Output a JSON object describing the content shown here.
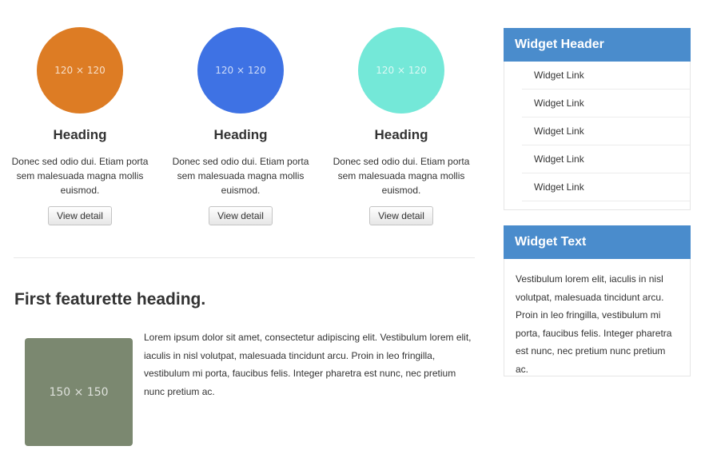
{
  "columns": [
    {
      "placeholder": "120 × 120",
      "color": "#dd7c24",
      "heading": "Heading",
      "text": "Donec sed odio dui. Etiam porta sem malesuada magna mollis euismod.",
      "button": "View detail"
    },
    {
      "placeholder": "120 × 120",
      "color": "#3e72e4",
      "heading": "Heading",
      "text": "Donec sed odio dui. Etiam porta sem malesuada magna mollis euismod.",
      "button": "View detail"
    },
    {
      "placeholder": "120 × 120",
      "color": "#74e8d8",
      "heading": "Heading",
      "text": "Donec sed odio dui. Etiam porta sem malesuada magna mollis euismod.",
      "button": "View detail"
    }
  ],
  "featurette": {
    "heading": "First featurette heading.",
    "image_placeholder": "150 × 150",
    "image_color": "#7b8870",
    "text": "Lorem ipsum dolor sit amet, consectetur adipiscing elit. Vestibulum lorem elit, iaculis in nisl volutpat, malesuada tincidunt arcu. Proin in leo fringilla, vestibulum mi porta, faucibus felis. Integer pharetra est nunc, nec pretium nunc pretium ac."
  },
  "widget_header": {
    "title": "Widget Header",
    "links": [
      "Widget Link",
      "Widget Link",
      "Widget Link",
      "Widget Link",
      "Widget Link"
    ]
  },
  "widget_text": {
    "title": "Widget Text",
    "body": "Vestibulum lorem elit, iaculis in nisl volutpat, malesuada tincidunt arcu. Proin in leo fringilla, vestibulum mi porta, faucibus felis. Integer pharetra est nunc, nec pretium nunc pretium ac."
  },
  "colors": {
    "widget_header_bg": "#4a8ccc"
  }
}
